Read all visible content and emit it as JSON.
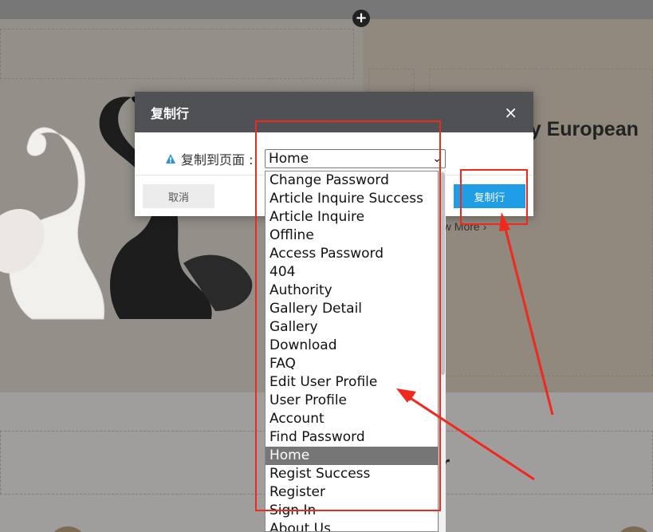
{
  "background": {
    "heading_fragment": "ry European",
    "link_text": "ew More ›",
    "big_letter": "r",
    "add_button": "+"
  },
  "dialog": {
    "title": "复制行",
    "close_icon": "×",
    "field_label": "复制到页面 :",
    "selected_value": "Home",
    "cancel_label": "取消",
    "confirm_label": "复制行"
  },
  "dropdown": {
    "options": [
      "Change Password",
      "Article Inquire Success",
      "Article Inquire",
      "Offline",
      "Access Password",
      "404",
      "Authority",
      "Gallery Detail",
      "Gallery",
      "Download",
      "FAQ",
      "Edit User Profile",
      "User Profile",
      "Account",
      "Find Password",
      "Home",
      "Regist Success",
      "Register",
      "Sign In",
      "About Us"
    ],
    "selected_index": 15
  },
  "colors": {
    "dialog_header": "#4f5155",
    "confirm_button": "#1f9ee6",
    "annotation": "#f0281e",
    "warning_icon": "#2f8fd8"
  }
}
